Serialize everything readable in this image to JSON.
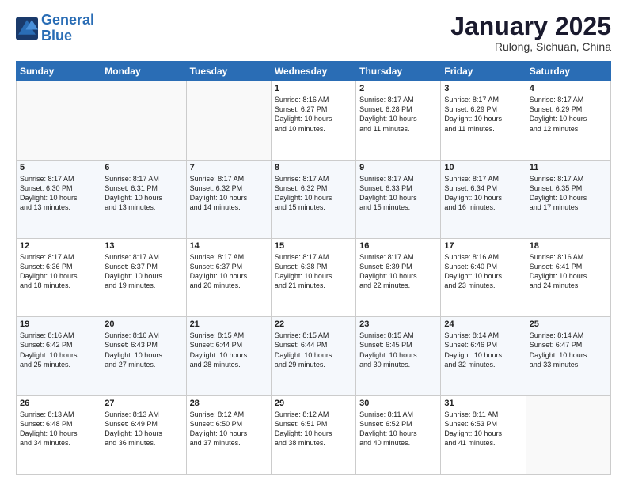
{
  "logo": {
    "line1": "General",
    "line2": "Blue"
  },
  "title": "January 2025",
  "location": "Rulong, Sichuan, China",
  "weekdays": [
    "Sunday",
    "Monday",
    "Tuesday",
    "Wednesday",
    "Thursday",
    "Friday",
    "Saturday"
  ],
  "weeks": [
    [
      {
        "day": "",
        "info": ""
      },
      {
        "day": "",
        "info": ""
      },
      {
        "day": "",
        "info": ""
      },
      {
        "day": "1",
        "info": "Sunrise: 8:16 AM\nSunset: 6:27 PM\nDaylight: 10 hours\nand 10 minutes."
      },
      {
        "day": "2",
        "info": "Sunrise: 8:17 AM\nSunset: 6:28 PM\nDaylight: 10 hours\nand 11 minutes."
      },
      {
        "day": "3",
        "info": "Sunrise: 8:17 AM\nSunset: 6:29 PM\nDaylight: 10 hours\nand 11 minutes."
      },
      {
        "day": "4",
        "info": "Sunrise: 8:17 AM\nSunset: 6:29 PM\nDaylight: 10 hours\nand 12 minutes."
      }
    ],
    [
      {
        "day": "5",
        "info": "Sunrise: 8:17 AM\nSunset: 6:30 PM\nDaylight: 10 hours\nand 13 minutes."
      },
      {
        "day": "6",
        "info": "Sunrise: 8:17 AM\nSunset: 6:31 PM\nDaylight: 10 hours\nand 13 minutes."
      },
      {
        "day": "7",
        "info": "Sunrise: 8:17 AM\nSunset: 6:32 PM\nDaylight: 10 hours\nand 14 minutes."
      },
      {
        "day": "8",
        "info": "Sunrise: 8:17 AM\nSunset: 6:32 PM\nDaylight: 10 hours\nand 15 minutes."
      },
      {
        "day": "9",
        "info": "Sunrise: 8:17 AM\nSunset: 6:33 PM\nDaylight: 10 hours\nand 15 minutes."
      },
      {
        "day": "10",
        "info": "Sunrise: 8:17 AM\nSunset: 6:34 PM\nDaylight: 10 hours\nand 16 minutes."
      },
      {
        "day": "11",
        "info": "Sunrise: 8:17 AM\nSunset: 6:35 PM\nDaylight: 10 hours\nand 17 minutes."
      }
    ],
    [
      {
        "day": "12",
        "info": "Sunrise: 8:17 AM\nSunset: 6:36 PM\nDaylight: 10 hours\nand 18 minutes."
      },
      {
        "day": "13",
        "info": "Sunrise: 8:17 AM\nSunset: 6:37 PM\nDaylight: 10 hours\nand 19 minutes."
      },
      {
        "day": "14",
        "info": "Sunrise: 8:17 AM\nSunset: 6:37 PM\nDaylight: 10 hours\nand 20 minutes."
      },
      {
        "day": "15",
        "info": "Sunrise: 8:17 AM\nSunset: 6:38 PM\nDaylight: 10 hours\nand 21 minutes."
      },
      {
        "day": "16",
        "info": "Sunrise: 8:17 AM\nSunset: 6:39 PM\nDaylight: 10 hours\nand 22 minutes."
      },
      {
        "day": "17",
        "info": "Sunrise: 8:16 AM\nSunset: 6:40 PM\nDaylight: 10 hours\nand 23 minutes."
      },
      {
        "day": "18",
        "info": "Sunrise: 8:16 AM\nSunset: 6:41 PM\nDaylight: 10 hours\nand 24 minutes."
      }
    ],
    [
      {
        "day": "19",
        "info": "Sunrise: 8:16 AM\nSunset: 6:42 PM\nDaylight: 10 hours\nand 25 minutes."
      },
      {
        "day": "20",
        "info": "Sunrise: 8:16 AM\nSunset: 6:43 PM\nDaylight: 10 hours\nand 27 minutes."
      },
      {
        "day": "21",
        "info": "Sunrise: 8:15 AM\nSunset: 6:44 PM\nDaylight: 10 hours\nand 28 minutes."
      },
      {
        "day": "22",
        "info": "Sunrise: 8:15 AM\nSunset: 6:44 PM\nDaylight: 10 hours\nand 29 minutes."
      },
      {
        "day": "23",
        "info": "Sunrise: 8:15 AM\nSunset: 6:45 PM\nDaylight: 10 hours\nand 30 minutes."
      },
      {
        "day": "24",
        "info": "Sunrise: 8:14 AM\nSunset: 6:46 PM\nDaylight: 10 hours\nand 32 minutes."
      },
      {
        "day": "25",
        "info": "Sunrise: 8:14 AM\nSunset: 6:47 PM\nDaylight: 10 hours\nand 33 minutes."
      }
    ],
    [
      {
        "day": "26",
        "info": "Sunrise: 8:13 AM\nSunset: 6:48 PM\nDaylight: 10 hours\nand 34 minutes."
      },
      {
        "day": "27",
        "info": "Sunrise: 8:13 AM\nSunset: 6:49 PM\nDaylight: 10 hours\nand 36 minutes."
      },
      {
        "day": "28",
        "info": "Sunrise: 8:12 AM\nSunset: 6:50 PM\nDaylight: 10 hours\nand 37 minutes."
      },
      {
        "day": "29",
        "info": "Sunrise: 8:12 AM\nSunset: 6:51 PM\nDaylight: 10 hours\nand 38 minutes."
      },
      {
        "day": "30",
        "info": "Sunrise: 8:11 AM\nSunset: 6:52 PM\nDaylight: 10 hours\nand 40 minutes."
      },
      {
        "day": "31",
        "info": "Sunrise: 8:11 AM\nSunset: 6:53 PM\nDaylight: 10 hours\nand 41 minutes."
      },
      {
        "day": "",
        "info": ""
      }
    ]
  ]
}
